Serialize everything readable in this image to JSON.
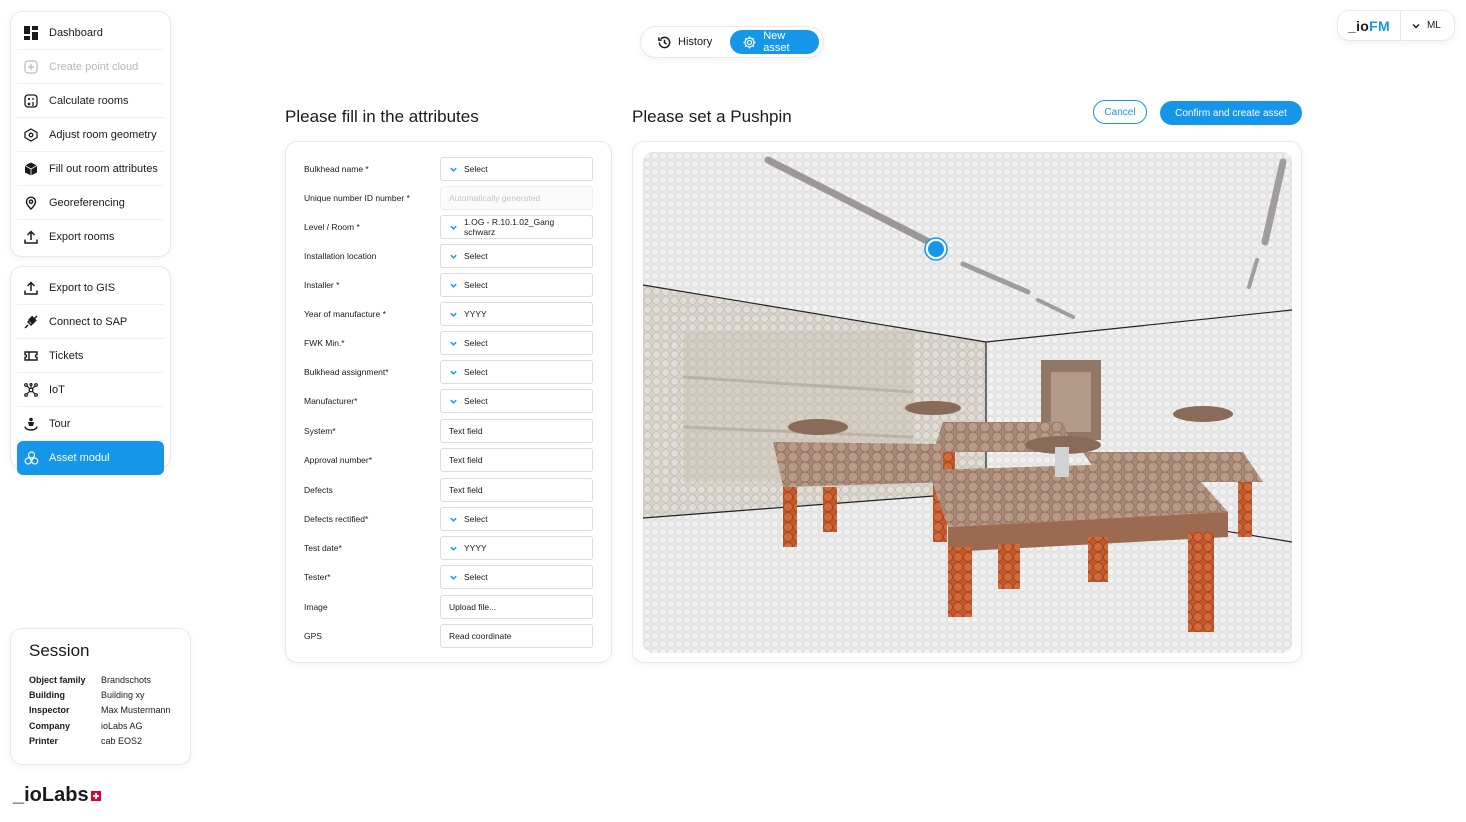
{
  "menu_top": [
    {
      "label": "Dashboard",
      "icon": "dashboard-icon"
    },
    {
      "label": "Create point cloud",
      "icon": "plus-square-icon",
      "disabled": true
    },
    {
      "label": "Calculate rooms",
      "icon": "calculator-icon"
    },
    {
      "label": "Adjust room geometry",
      "icon": "geometry-icon"
    },
    {
      "label": "Fill out room attributes",
      "icon": "cube-icon"
    },
    {
      "label": "Georeferencing",
      "icon": "location-pin-icon"
    },
    {
      "label": "Export rooms",
      "icon": "export-icon"
    }
  ],
  "menu_bottom": [
    {
      "label": "Export to GIS",
      "icon": "export-icon"
    },
    {
      "label": "Connect to SAP",
      "icon": "plug-icon"
    },
    {
      "label": "Tickets",
      "icon": "ticket-icon"
    },
    {
      "label": "IoT",
      "icon": "network-icon"
    },
    {
      "label": "Tour",
      "icon": "tour-icon"
    },
    {
      "label": "Asset modul",
      "icon": "asset-icon",
      "active": true
    }
  ],
  "session": {
    "title": "Session",
    "rows": [
      {
        "k": "Object family",
        "v": "Brandschots"
      },
      {
        "k": "Building",
        "v": "Building xy"
      },
      {
        "k": "Inspector",
        "v": "Max Mustermann"
      },
      {
        "k": "Company",
        "v": "ioLabs AG"
      },
      {
        "k": "Printer",
        "v": "cab EOS2"
      }
    ]
  },
  "logo": {
    "text": "_ioLabs"
  },
  "topbar": {
    "history": "History",
    "new_asset": "New asset"
  },
  "header": {
    "brand_prefix": "_io",
    "brand_suffix": "FM",
    "user": "ML"
  },
  "form": {
    "title": "Please fill in the attributes",
    "fields": [
      {
        "label": "Bulkhead name *",
        "value": "Select",
        "type": "select"
      },
      {
        "label": "Unique number ID number *",
        "value": "Automatically generated",
        "type": "readonly"
      },
      {
        "label": "Level / Room *",
        "value": "1.OG - R.10.1.02_Gang schwarz",
        "type": "select"
      },
      {
        "label": "Installation location",
        "value": "Select",
        "type": "select"
      },
      {
        "label": "Installer *",
        "value": "Select",
        "type": "select"
      },
      {
        "label": "Year of manufacture *",
        "value": "YYYY",
        "type": "select"
      },
      {
        "label": "FWK Min.*",
        "value": "Select",
        "type": "select"
      },
      {
        "label": "Bulkhead assignment*",
        "value": "Select",
        "type": "select"
      },
      {
        "label": "Manufacturer*",
        "value": "Select",
        "type": "select"
      },
      {
        "label": "System*",
        "value": "Text field",
        "type": "text"
      },
      {
        "label": "Approval number*",
        "value": "Text field",
        "type": "text"
      },
      {
        "label": "Defects",
        "value": "Text field",
        "type": "text"
      },
      {
        "label": "Defects rectified*",
        "value": "Select",
        "type": "select"
      },
      {
        "label": "Test date*",
        "value": "YYYY",
        "type": "select"
      },
      {
        "label": "Tester*",
        "value": "Select",
        "type": "select"
      },
      {
        "label": "Image",
        "value": "Upload file...",
        "type": "text"
      },
      {
        "label": "GPS",
        "value": "Read coordinate",
        "type": "text"
      }
    ]
  },
  "pushpin": {
    "title": "Please set a Pushpin",
    "cancel": "Cancel",
    "confirm": "Confirm and create asset"
  },
  "colors": {
    "accent": "#1596e8",
    "table": "#c4592b"
  }
}
